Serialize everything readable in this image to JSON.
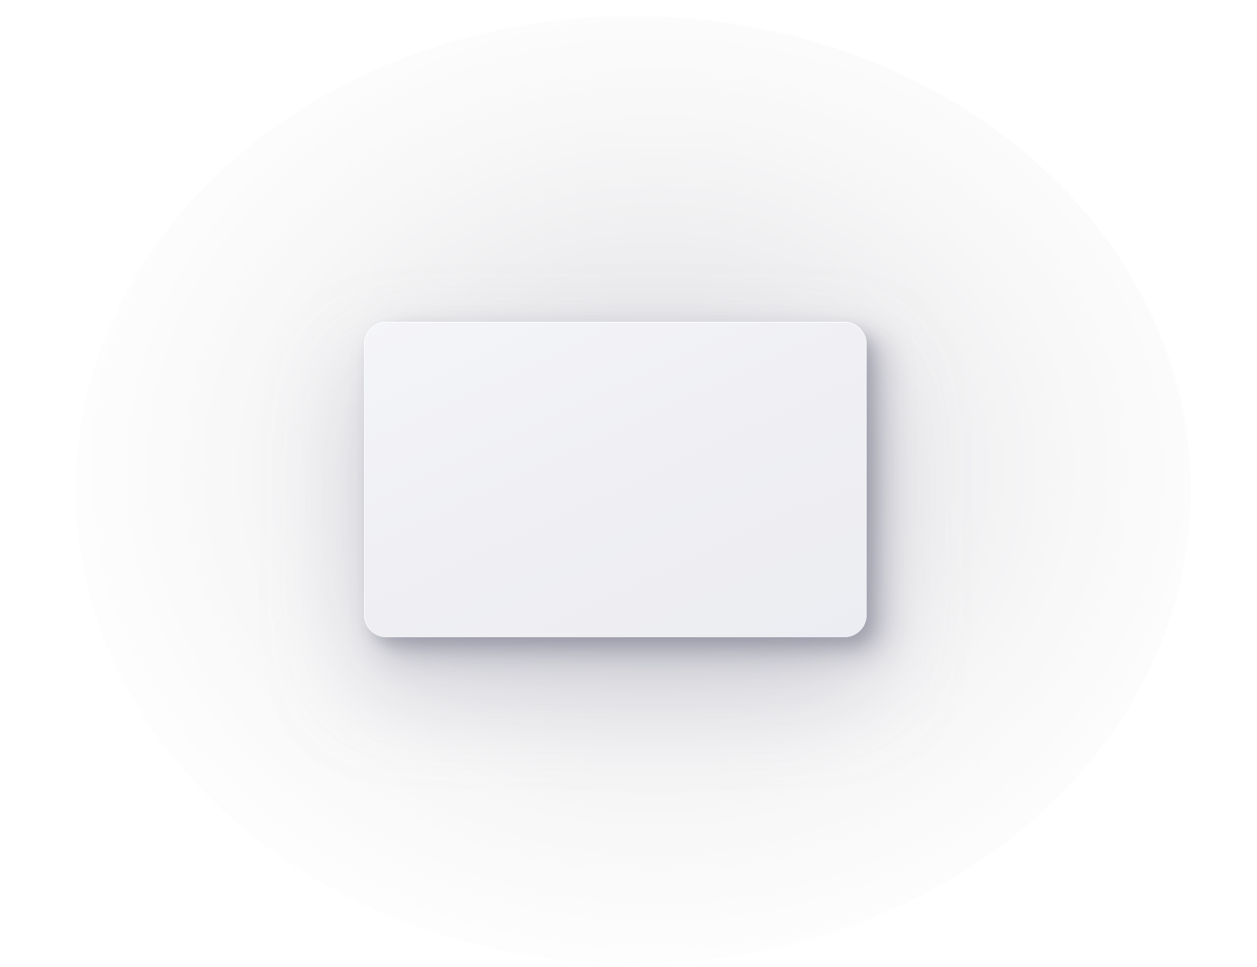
{
  "card": {
    "fill_color": "#efeff3",
    "shadow_color": "#8a8a9a"
  },
  "background": {
    "color": "#ffffff"
  }
}
